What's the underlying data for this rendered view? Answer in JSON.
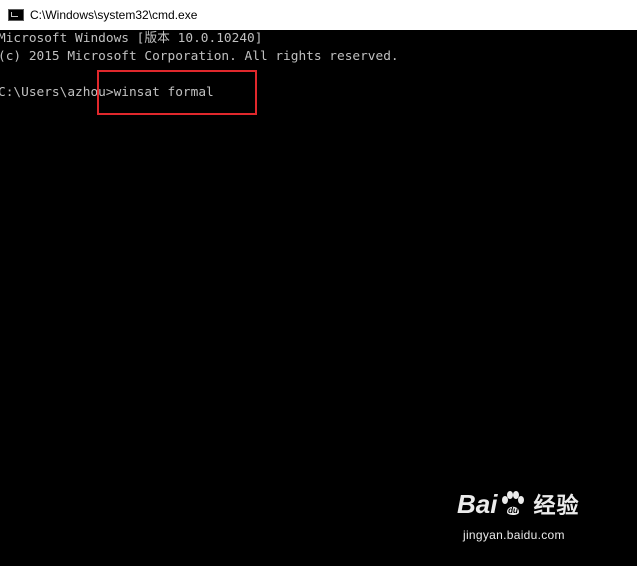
{
  "window": {
    "title": "C:\\Windows\\system32\\cmd.exe",
    "icon": "console-icon"
  },
  "console": {
    "lines": [
      "Microsoft Windows [版本 10.0.10240]",
      "(c) 2015 Microsoft Corporation. All rights reserved.",
      "",
      "C:\\Users\\azhou>winsat formal"
    ],
    "text_color": "#c0c0c0",
    "background": "#000000"
  },
  "annotation": {
    "highlight_color": "#e0282c"
  },
  "watermark": {
    "logo_left": "Bai",
    "logo_right": "经验",
    "url": "jingyan.baidu.com"
  }
}
